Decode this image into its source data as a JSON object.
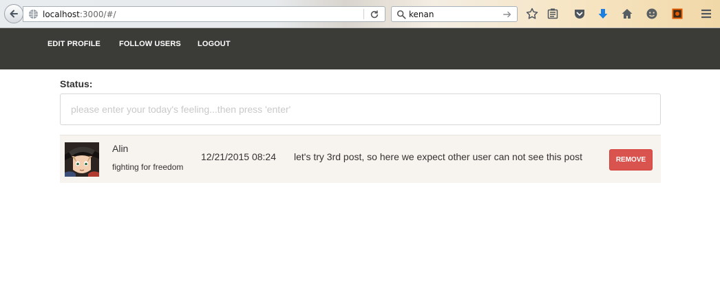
{
  "browser": {
    "url_host": "localhost",
    "url_rest": ":3000/#/",
    "search_value": "kenan"
  },
  "nav": {
    "items": [
      {
        "label": "EDIT PROFILE"
      },
      {
        "label": "FOLLOW USERS"
      },
      {
        "label": "LOGOUT"
      }
    ]
  },
  "status": {
    "label": "Status:",
    "placeholder": "please enter your today's feeling...then press 'enter'",
    "value": ""
  },
  "posts": [
    {
      "user_name": "Alin",
      "tagline": "fighting for freedom",
      "time": "12/21/2015 08:24",
      "text": "let's try 3rd post, so here we expect other user can not see this post",
      "remove_label": "REMOVE"
    }
  ],
  "colors": {
    "nav_bg": "#3b3c37",
    "remove_bg": "#d9534f",
    "row_bg": "#f7f3ee"
  },
  "icons": [
    "back-arrow-icon",
    "globe-icon",
    "reload-icon",
    "search-icon",
    "go-arrow-icon",
    "bookmark-star-icon",
    "reading-list-icon",
    "pocket-icon",
    "download-icon",
    "home-icon",
    "emoji-icon",
    "extension-icon",
    "hamburger-menu-icon"
  ]
}
